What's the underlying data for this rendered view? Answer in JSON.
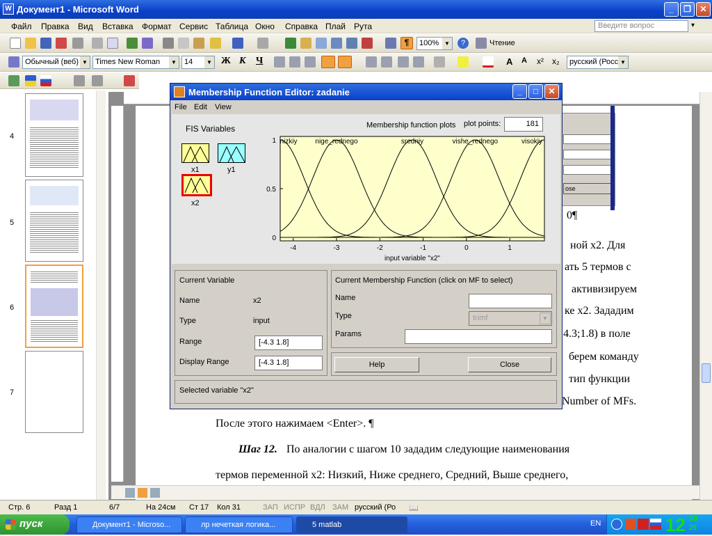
{
  "word": {
    "title": "Документ1 - Microsoft Word",
    "menu": [
      "Файл",
      "Правка",
      "Вид",
      "Вставка",
      "Формат",
      "Сервис",
      "Таблица",
      "Окно",
      "Справка",
      "Плай",
      "Рута"
    ],
    "ask_placeholder": "Введите вопрос",
    "zoom": "100%",
    "read_label": "Чтение",
    "style": "Обычный (веб)",
    "font": "Times New Roman",
    "size": "14",
    "bold": "Ж",
    "italic": "К",
    "underline": "Ч",
    "lang_combo": "русский (Росси"
  },
  "thumbnails": [
    {
      "num": "4"
    },
    {
      "num": "5"
    },
    {
      "num": "6"
    },
    {
      "num": "7"
    }
  ],
  "document": {
    "right_lines": [
      {
        "text": "0¶"
      },
      {
        "text": "ной   x2.   Для"
      },
      {
        "text": "ать  5  термов  с"
      },
      {
        "text": "активизируем"
      },
      {
        "text": "ке x2. Зададим"
      },
      {
        "text": "4.3;1.8)  в  поле"
      },
      {
        "text": "берем  команду"
      },
      {
        "text": "тип   функции"
      },
      {
        "text": "Number of MFs."
      }
    ],
    "line_after": "После этого нажимаем <Enter>. ¶",
    "step_label": "Шаг 12.",
    "step_text": " По  аналогии  с  шагом 10  зададим  следующие  наименования",
    "last_line": "термов  переменной  x2:  Низкий,  Ниже среднего,  Средний,  Выше среднего,"
  },
  "status": {
    "page": "Стр. 6",
    "section": "Разд 1",
    "pages": "6/7",
    "at": "На 24см",
    "line": "Ст 17",
    "col": "Кол 31",
    "rec": "ЗАП",
    "trk": "ИСПР",
    "ext": "ВДЛ",
    "ovr": "ЗАМ",
    "lang": "русский (Ро"
  },
  "taskbar": {
    "start": "пуск",
    "tasks": [
      "Документ1 - Microso...",
      "лр нечеткая логика...",
      "5 matlab"
    ],
    "lang": "EN",
    "clock_h": "12",
    "clock_m": "18",
    "clock_s": "25"
  },
  "dialog": {
    "title": "Membership Function Editor: zadanie",
    "menu": [
      "File",
      "Edit",
      "View"
    ],
    "fis_vars_label": "FIS Variables",
    "vars": [
      {
        "name": "x1"
      },
      {
        "name": "y1"
      },
      {
        "name": "x2"
      }
    ],
    "plots_label": "Membership function plots",
    "plot_points_label": "plot points:",
    "plot_points": "181",
    "current_variable": {
      "heading": "Current Variable",
      "name_label": "Name",
      "name": "x2",
      "type_label": "Type",
      "type": "input",
      "range_label": "Range",
      "range": "[-4.3 1.8]",
      "display_range_label": "Display Range",
      "display_range": "[-4.3 1.8]"
    },
    "current_mf": {
      "heading": "Current Membership Function (click on MF to select)",
      "name_label": "Name",
      "type_label": "Type",
      "type_value": "trimf",
      "params_label": "Params"
    },
    "help_btn": "Help",
    "close_btn": "Close",
    "status": "Selected variable \"x2\""
  },
  "chart_data": {
    "type": "line",
    "xlabel": "input variable \"x2\"",
    "xlim": [
      -4.3,
      1.8
    ],
    "ylim": [
      0,
      1
    ],
    "xticks": [
      "-4",
      "-3",
      "-2",
      "-1",
      "0",
      "1"
    ],
    "yticks": [
      "0",
      "0.5",
      "1"
    ],
    "series": [
      {
        "name": "nizkiy",
        "center": -4.3,
        "sigma": 0.55
      },
      {
        "name": "nige_rednego",
        "center": -3.0,
        "sigma": 0.55
      },
      {
        "name": "sredniy",
        "center": -1.25,
        "sigma": 0.55
      },
      {
        "name": "vishe_rednego",
        "center": 0.2,
        "sigma": 0.55
      },
      {
        "name": "visokiy",
        "center": 1.8,
        "sigma": 0.55
      }
    ]
  }
}
